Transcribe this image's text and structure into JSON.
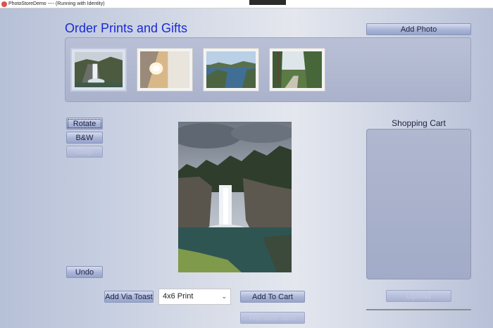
{
  "window": {
    "title": "PhotoStoreDemo ---- (Running with Identity)"
  },
  "header": {
    "title": "Order Prints and Gifts",
    "add_photo_label": "Add Photo"
  },
  "gallery": {
    "thumbnails": [
      {
        "name": "waterfall",
        "selected": true
      },
      {
        "name": "lamp"
      },
      {
        "name": "lake-bay"
      },
      {
        "name": "forest-trail"
      }
    ]
  },
  "edit_tools": {
    "rotate": "Rotate",
    "bw": "B&W",
    "crop": "Crop",
    "undo": "Undo"
  },
  "order": {
    "add_via_toast": "Add Via Toast",
    "print_size": "4x6 Print",
    "add_to_cart": "Add To Cart",
    "remove_item": "Remove Item"
  },
  "cart": {
    "title": "Shopping Cart",
    "upload": "Upload"
  },
  "icons": {
    "select_arrow": "chevron-down-icon",
    "app_icon": "app-icon"
  },
  "colors": {
    "title_blue": "#1a2bd4",
    "button_face": "#a9b4d6",
    "disabled_text": "#c5cbe0"
  }
}
